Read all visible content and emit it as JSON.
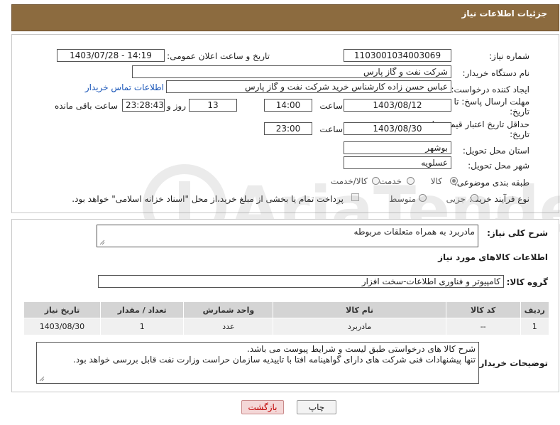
{
  "header": {
    "title": "جزئیات اطلاعات نیاز"
  },
  "form": {
    "need_number_label": "شماره نیاز:",
    "need_number": "1103001034003069",
    "announce_label": "تاریخ و ساعت اعلان عمومی:",
    "announce_value": "1403/07/28 - 14:19",
    "buyer_org_label": "نام دستگاه خریدار:",
    "buyer_org": "شرکت نفت و گاز پارس",
    "creator_label": "ایجاد کننده درخواست:",
    "creator": "عباس حسن زاده کارشناس خرید شرکت نفت و گاز پارس",
    "contact_link": "اطلاعات تماس خریدار",
    "deadline_label_1": "مهلت ارسال پاسخ: تا",
    "deadline_label_2": "تاریخ:",
    "deadline_date": "1403/08/12",
    "time_label": "ساعت",
    "deadline_time": "14:00",
    "days_count": "13",
    "days_label": "روز و",
    "remaining_time": "23:28:43",
    "remaining_label": "ساعت باقی مانده",
    "validity_label_1": "حداقل تاریخ اعتبار قیمت: تا",
    "validity_label_2": "تاریخ:",
    "validity_date": "1403/08/30",
    "validity_time_label": "ساعت",
    "validity_time": "23:00",
    "province_label": "استان محل تحویل:",
    "province": "بوشهر",
    "city_label": "شهر محل تحویل:",
    "city": "عسلویه",
    "category_label": "طبقه بندی موضوعی:",
    "category_options": [
      "کالا",
      "خدمت",
      "کالا/خدمت"
    ],
    "process_label": "نوع فرآیند خرید :",
    "process_options": [
      "جزیی",
      "متوسط"
    ],
    "payment_note": "پرداخت تمام یا بخشی از مبلغ خرید،از محل \"اسناد خزانه اسلامی\" خواهد بود."
  },
  "details": {
    "description_label": "شرح کلی نیاز:",
    "description": "مادربرد به همراه متعلقات مربوطه",
    "goods_info_title": "اطلاعات کالاهای مورد نیاز",
    "goods_group_label": "گروه کالا:",
    "goods_group": "کامپیوتر و فناوری اطلاعات-سخت افزار",
    "table": {
      "headers": [
        "ردیف",
        "کد کالا",
        "نام کالا",
        "واحد شمارش",
        "تعداد / مقدار",
        "تاریخ نیاز"
      ],
      "rows": [
        [
          "1",
          "--",
          "مادربرد",
          "عدد",
          "1",
          "1403/08/30"
        ]
      ]
    },
    "buyer_notes_label": "توضیحات خریدار:",
    "buyer_notes_line1": "شرح کالا های درخواستی طبق لیست و شرایط پیوست می باشد.",
    "buyer_notes_line2": "تنها پیشنهادات فنی شرکت های دارای گواهینامه افتا با تاییدیه سازمان حراست وزارت نفت قابل بررسی خواهد بود."
  },
  "buttons": {
    "print": "چاپ",
    "back": "بازگشت"
  },
  "colors": {
    "header_bg": "#8c6b3f",
    "link": "#1a56b8",
    "back_button": "#f4d7d7"
  }
}
